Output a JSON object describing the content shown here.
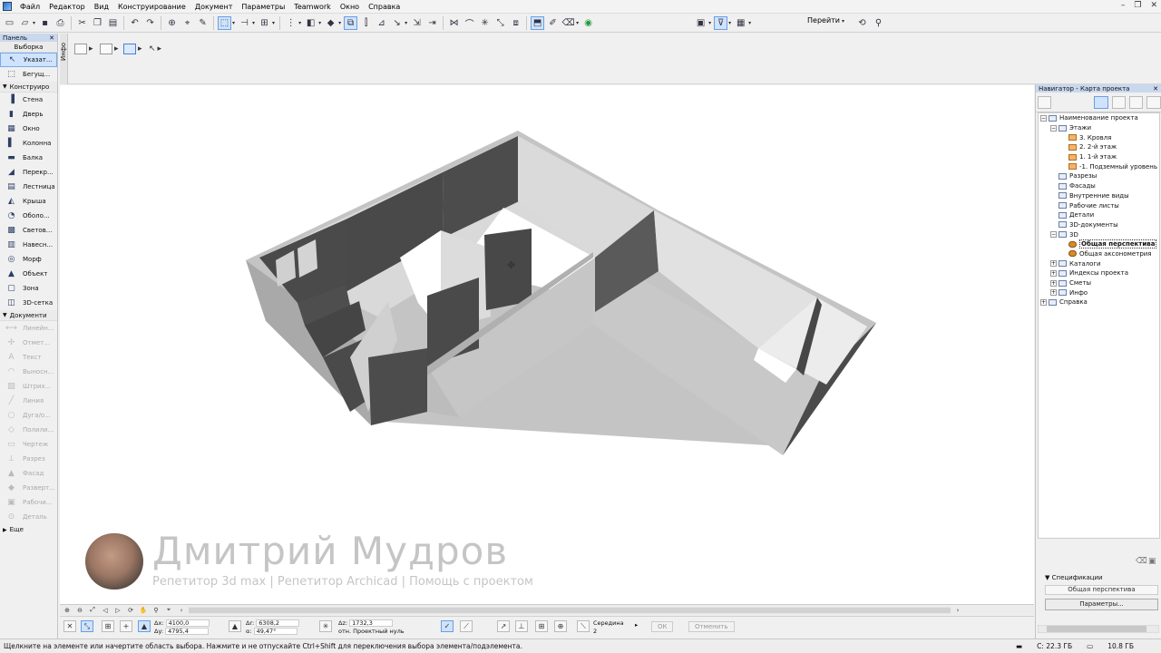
{
  "menubar": {
    "items": [
      "Файл",
      "Редактор",
      "Вид",
      "Конструирование",
      "Документ",
      "Параметры",
      "Teamwork",
      "Окно",
      "Справка"
    ],
    "win_minimize": "–",
    "win_restore": "❐",
    "win_close": "✕"
  },
  "toolbar": {
    "goto_label": "Перейти"
  },
  "toolbox": {
    "title": "Панель",
    "selection_header": "Выборка",
    "arrow_tool": "Указат...",
    "marquee_tool": "Бегущ...",
    "group_design": "Конструиро",
    "design_tools": [
      "Стена",
      "Дверь",
      "Окно",
      "Колонна",
      "Балка",
      "Перекр...",
      "Лестница",
      "Крыша",
      "Оболо...",
      "Светов...",
      "Навесн...",
      "Морф",
      "Объект",
      "Зона",
      "3D-сетка"
    ],
    "group_document": "Документи",
    "document_tools": [
      "Линейн...",
      "Отмет...",
      "Текст",
      "Выносн...",
      "Штрих...",
      "Линия",
      "Дуга/о...",
      "Полили...",
      "Чертеж",
      "Разрез",
      "Фасад",
      "Разверт...",
      "Рабочи...",
      "Деталь"
    ],
    "more": "Еще"
  },
  "infobox": {
    "vertical_label": "Инфо"
  },
  "navigator": {
    "title": "Навигатор - Карта проекта",
    "tree": [
      {
        "label": "Наименование проекта",
        "level": 0,
        "exp": "−",
        "icon": "project"
      },
      {
        "label": "Этажи",
        "level": 1,
        "exp": "−",
        "icon": "folder"
      },
      {
        "label": "3. Кровля",
        "level": 2,
        "exp": "",
        "icon": "story"
      },
      {
        "label": "2. 2-й этаж",
        "level": 2,
        "exp": "",
        "icon": "story"
      },
      {
        "label": "1. 1-й этаж",
        "level": 2,
        "exp": "",
        "icon": "story"
      },
      {
        "label": "-1. Подземный уровень",
        "level": 2,
        "exp": "",
        "icon": "story"
      },
      {
        "label": "Разрезы",
        "level": 1,
        "exp": "",
        "icon": "folder"
      },
      {
        "label": "Фасады",
        "level": 1,
        "exp": "",
        "icon": "folder"
      },
      {
        "label": "Внутренние виды",
        "level": 1,
        "exp": "",
        "icon": "folder"
      },
      {
        "label": "Рабочие листы",
        "level": 1,
        "exp": "",
        "icon": "folder"
      },
      {
        "label": "Детали",
        "level": 1,
        "exp": "",
        "icon": "folder"
      },
      {
        "label": "3D-документы",
        "level": 1,
        "exp": "",
        "icon": "folder"
      },
      {
        "label": "3D",
        "level": 1,
        "exp": "−",
        "icon": "folder"
      },
      {
        "label": "Общая перспектива",
        "level": 2,
        "exp": "",
        "icon": "cam",
        "selected": true
      },
      {
        "label": "Общая аксонометрия",
        "level": 2,
        "exp": "",
        "icon": "cam"
      },
      {
        "label": "Каталоги",
        "level": 1,
        "exp": "+",
        "icon": "folder"
      },
      {
        "label": "Индексы проекта",
        "level": 1,
        "exp": "+",
        "icon": "folder"
      },
      {
        "label": "Сметы",
        "level": 1,
        "exp": "+",
        "icon": "folder"
      },
      {
        "label": "Инфо",
        "level": 1,
        "exp": "+",
        "icon": "folder"
      },
      {
        "label": "Справка",
        "level": 0,
        "exp": "+",
        "icon": "folder"
      }
    ],
    "specifications_label": "Спецификации",
    "current_view": "Общая перспектива",
    "params_button": "Параметры..."
  },
  "watermark": {
    "name": "Дмитрий Мудров",
    "subtitle": "Репетитор 3d max  |  Репетитор Archicad  |  Помощь с проектом"
  },
  "coordbar": {
    "dx_label": "Δx:",
    "dx_value": "4100,0",
    "dy_label": "Δy:",
    "dy_value": "4795,4",
    "dr_label": "Δr:",
    "dr_value": "6308,2",
    "angle_label": "α:",
    "angle_value": "49,47°",
    "dz_label": "Δz:",
    "dz_value": "1732,3",
    "ref_label": "отн. Проектный нуль",
    "snap_label": "Середина",
    "snap_sub": "2",
    "ok_label": "ОК",
    "cancel_label": "Отменить"
  },
  "status": {
    "hint": "Щелкните на элементе или начертите область выбора. Нажмите и не отпускайте Ctrl+Shift для переключения выбора элемента/подэлемента.",
    "disk_c": "C: 22.3 ГБ",
    "memory": "10.8 ГБ"
  }
}
